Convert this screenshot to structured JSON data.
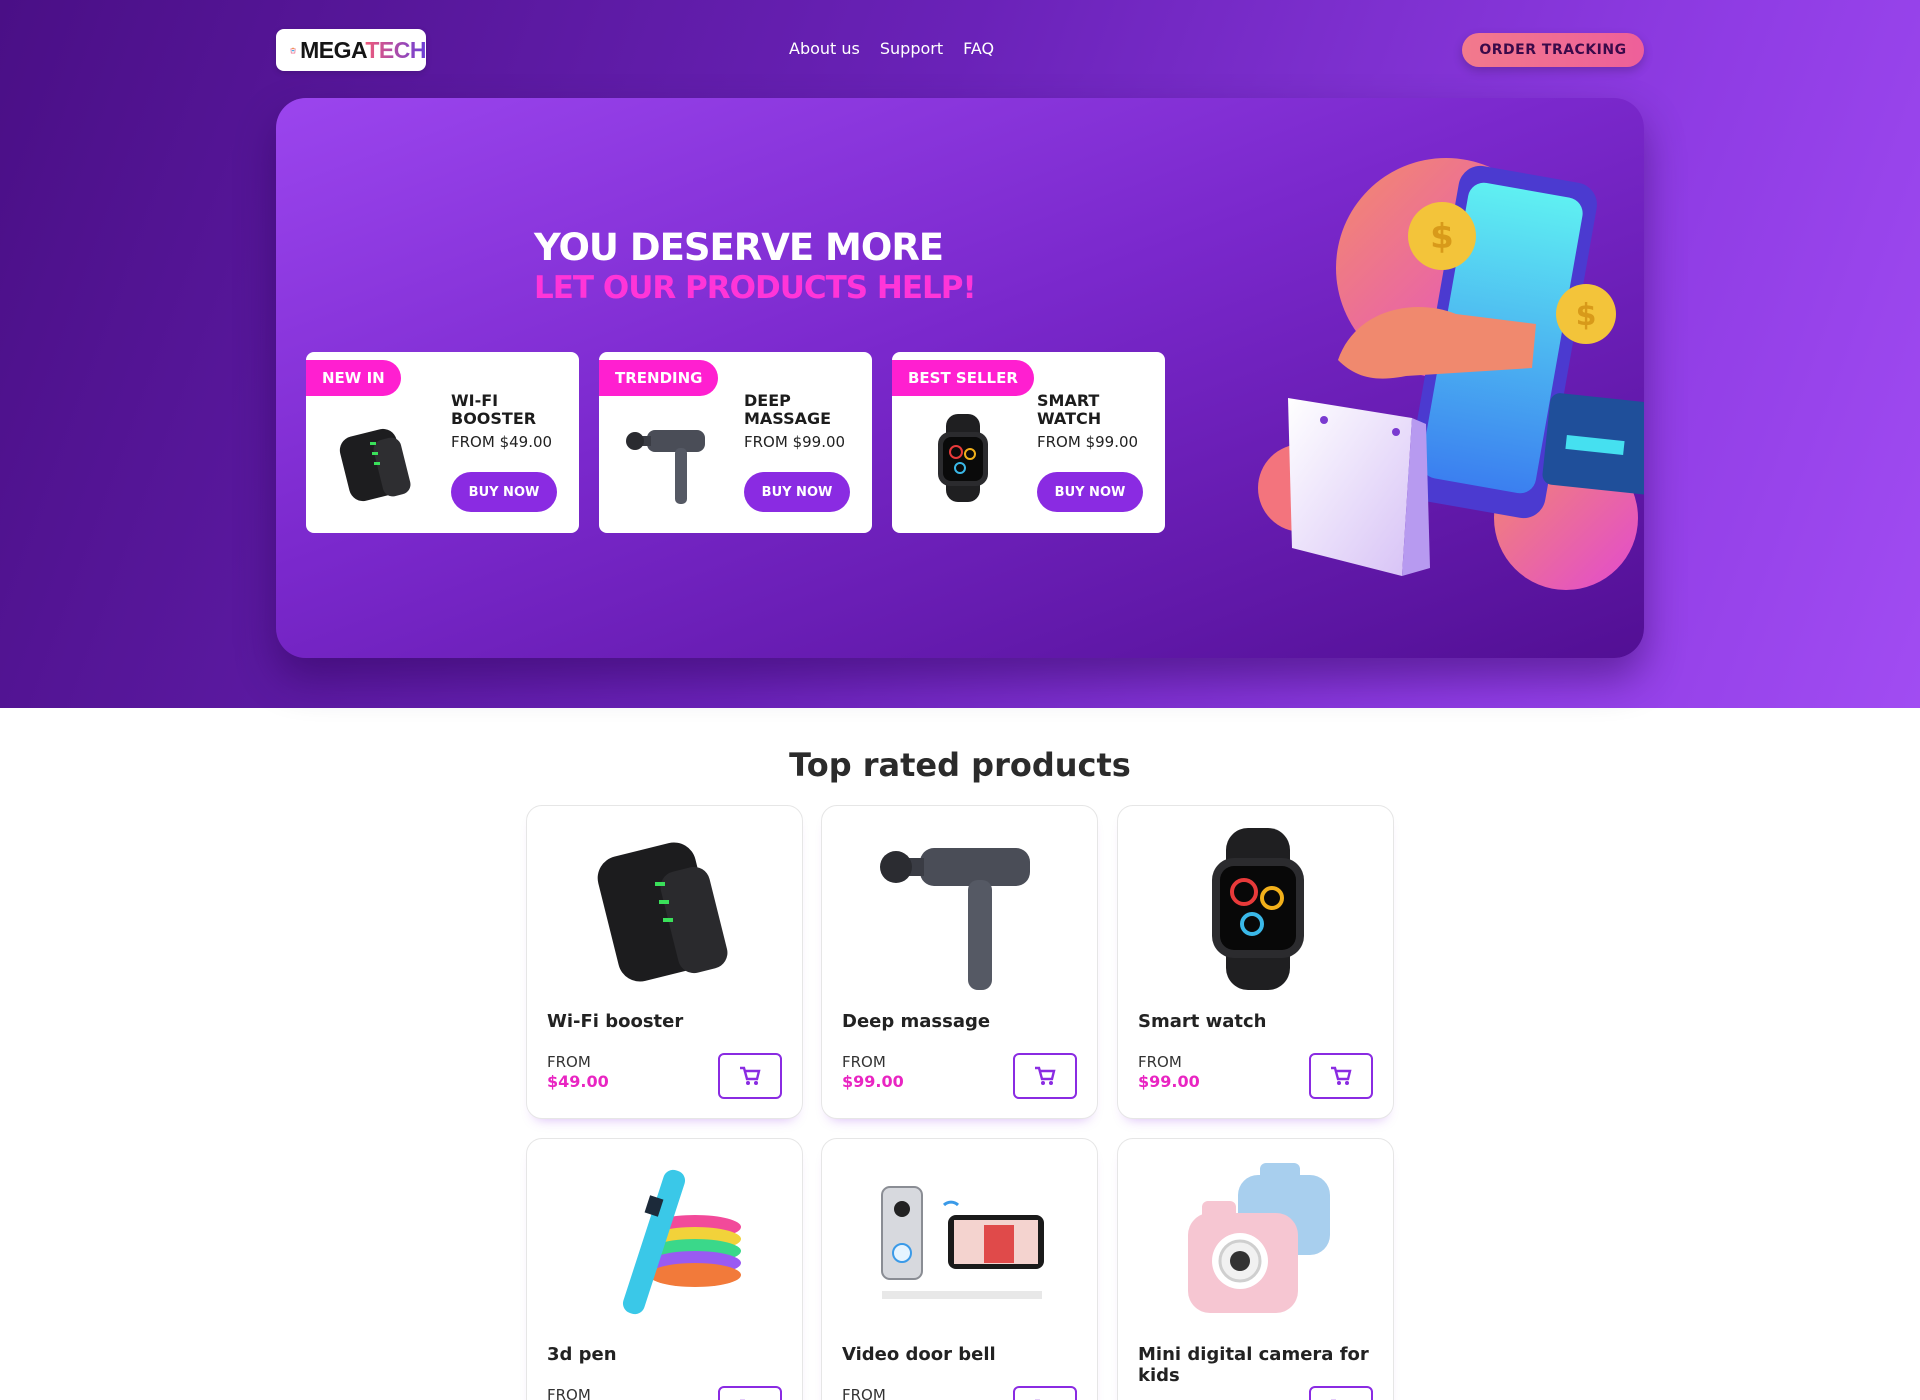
{
  "header": {
    "logo_text_mega": "MEGA",
    "logo_text_tech": "TECH",
    "nav": [
      "About us",
      "Support",
      "FAQ"
    ],
    "order_tracking": "ORDER TRACKING"
  },
  "hero": {
    "title": "YOU DESERVE MORE",
    "subtitle": "LET OUR PRODUCTS HELP!",
    "promos": [
      {
        "tag": "NEW IN",
        "name": "WI-FI BOOSTER",
        "price": "FROM $49.00",
        "button": "BUY NOW"
      },
      {
        "tag": "TRENDING",
        "name": "DEEP MASSAGE",
        "price": "FROM $99.00",
        "button": "BUY NOW"
      },
      {
        "tag": "BEST SELLER",
        "name": "SMART WATCH",
        "price": "FROM $99.00",
        "button": "BUY NOW"
      }
    ]
  },
  "top_rated": {
    "title": "Top rated products",
    "products": [
      {
        "name": "Wi-Fi booster",
        "from": "FROM",
        "price": "$49.00",
        "icon": "wifi-booster"
      },
      {
        "name": "Deep massage",
        "from": "FROM",
        "price": "$99.00",
        "icon": "massage-gun"
      },
      {
        "name": "Smart watch",
        "from": "FROM",
        "price": "$99.00",
        "icon": "smart-watch"
      },
      {
        "name": "3d pen",
        "from": "FROM",
        "price": "",
        "icon": "3d-pen"
      },
      {
        "name": "Video door bell",
        "from": "FROM",
        "price": "",
        "icon": "video-doorbell"
      },
      {
        "name": "Mini digital camera for kids",
        "from": "FROM",
        "price": "",
        "icon": "kids-camera"
      }
    ]
  },
  "colors": {
    "accent_purple": "#8a2be2",
    "accent_pink": "#ff1fd0",
    "price_pink": "#e925c2"
  }
}
